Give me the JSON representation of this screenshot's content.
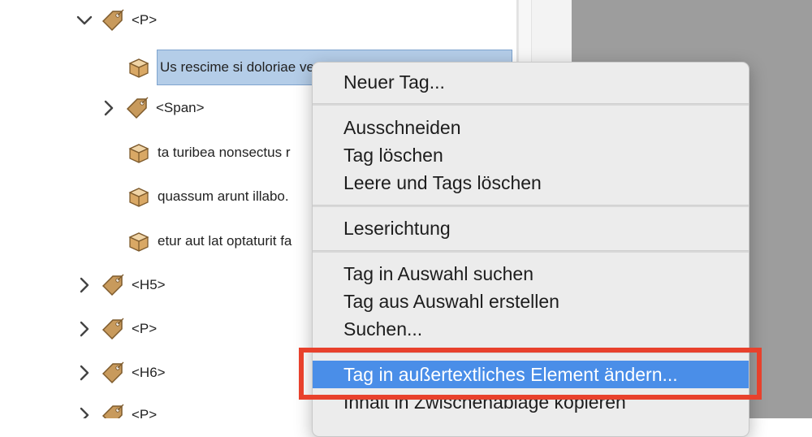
{
  "tree": {
    "items": [
      {
        "kind": "tag",
        "expanded": true,
        "label": "<P>"
      },
      {
        "kind": "text",
        "label": "Us rescime si doloriae venihic tempeum eost mee",
        "selected": true
      },
      {
        "kind": "tag",
        "expanded": false,
        "label": "<Span>"
      },
      {
        "kind": "text",
        "label": "ta turibea nonsectus r"
      },
      {
        "kind": "text",
        "label": "quassum arunt illabo."
      },
      {
        "kind": "text",
        "label": "etur aut lat optaturit fa"
      },
      {
        "kind": "tag",
        "expanded": false,
        "label": "<H5>"
      },
      {
        "kind": "tag",
        "expanded": false,
        "label": "<P>"
      },
      {
        "kind": "tag",
        "expanded": false,
        "label": "<H6>"
      },
      {
        "kind": "tag",
        "expanded": false,
        "label": "<P>"
      }
    ]
  },
  "context_menu": {
    "groups": [
      [
        "Neuer Tag..."
      ],
      [
        "Ausschneiden",
        "Tag löschen",
        "Leere und Tags löschen"
      ],
      [
        "Leserichtung"
      ],
      [
        "Tag in Auswahl suchen",
        "Tag aus Auswahl erstellen",
        "Suchen..."
      ],
      [
        "Tag in außertextliches Element ändern...",
        "Inhalt in Zwischenablage kopieren"
      ]
    ],
    "highlighted": "Tag in außertextliches Element ändern..."
  },
  "colors": {
    "highlight": "#4a8ee8",
    "callout": "#e8412c",
    "selection": "#b4cde8"
  }
}
